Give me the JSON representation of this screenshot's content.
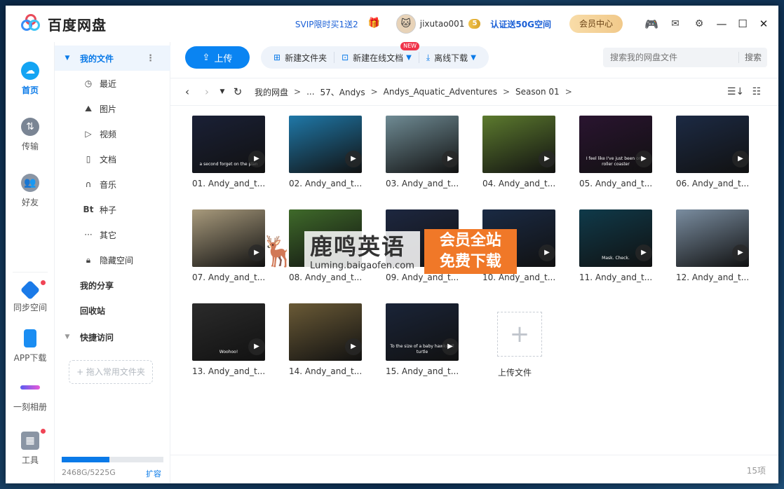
{
  "app": {
    "title": "百度网盘"
  },
  "header": {
    "promo": "SVIP限时买1送2",
    "username": "jixutao001",
    "level": "5",
    "verify_promo": "认证送50G空间",
    "vip_center": "会员中心"
  },
  "rail": {
    "items": [
      {
        "label": "首页",
        "icon": "cloud-icon",
        "active": true
      },
      {
        "label": "传输",
        "icon": "transfer-icon"
      },
      {
        "label": "好友",
        "icon": "friends-icon"
      },
      {
        "label": "同步空间",
        "icon": "sync-icon",
        "badge": true
      },
      {
        "label": "APP下载",
        "icon": "phone-icon"
      },
      {
        "label": "一刻相册",
        "icon": "album-icon"
      },
      {
        "label": "工具",
        "icon": "tools-icon",
        "badge": true
      }
    ]
  },
  "sidebar": {
    "my_files": "我的文件",
    "items": [
      {
        "label": "最近",
        "icon": "clock-icon"
      },
      {
        "label": "图片",
        "icon": "image-icon"
      },
      {
        "label": "视频",
        "icon": "play-icon"
      },
      {
        "label": "文档",
        "icon": "document-icon"
      },
      {
        "label": "音乐",
        "icon": "headphones-icon"
      },
      {
        "label": "种子",
        "icon": "bt-icon"
      },
      {
        "label": "其它",
        "icon": "more-icon"
      },
      {
        "label": "隐藏空间",
        "icon": "lock-icon"
      }
    ],
    "my_share": "我的分享",
    "recycle": "回收站",
    "quick_access": "快捷访问",
    "add_folder": "+ 拖入常用文件夹",
    "storage": {
      "text": "2468G/5225G",
      "used_fraction": 0.47
    },
    "expand": "扩容"
  },
  "toolbar": {
    "upload": "上传",
    "new_folder": "新建文件夹",
    "new_doc": "新建在线文档",
    "new_badge": "NEW",
    "offline": "离线下载",
    "search_placeholder": "搜索我的网盘文件",
    "search_btn": "搜索"
  },
  "breadcrumb": [
    "我的网盘",
    "...",
    "57、Andys",
    "Andys_Aquatic_Adventures",
    "Season 01"
  ],
  "files": [
    {
      "name": "01. Andy_and_t...",
      "caption": "a second forget on the plan",
      "bg": "#1a2036"
    },
    {
      "name": "02. Andy_and_t...",
      "caption": "",
      "bg": "#1f78a8"
    },
    {
      "name": "03. Andy_and_t...",
      "caption": "",
      "bg": "#6f8b94"
    },
    {
      "name": "04. Andy_and_t...",
      "caption": "",
      "bg": "#5c7a2e"
    },
    {
      "name": "05. Andy_and_t...",
      "caption": "I feel like I've just been on a roller coaster",
      "bg": "#2a1430"
    },
    {
      "name": "06. Andy_and_t...",
      "caption": "",
      "bg": "#1c2a44"
    },
    {
      "name": "07. Andy_and_t...",
      "caption": "",
      "bg": "#a89a7c"
    },
    {
      "name": "08. Andy_and_t...",
      "caption": "",
      "bg": "#3f6a2a"
    },
    {
      "name": "09. Andy_and_t...",
      "caption": "",
      "bg": "#1d2740"
    },
    {
      "name": "10. Andy_and_t...",
      "caption": "",
      "bg": "#1a2a44"
    },
    {
      "name": "11. Andy_and_t...",
      "caption": "Mask. Check.",
      "bg": "#0f3a4a"
    },
    {
      "name": "12. Andy_and_t...",
      "caption": "",
      "bg": "#7a8da0"
    },
    {
      "name": "13. Andy_and_t...",
      "caption": "Woohoo!",
      "bg": "#2b2b2b"
    },
    {
      "name": "14. Andy_and_t...",
      "caption": "",
      "bg": "#6a5a36"
    },
    {
      "name": "15. Andy_and_t...",
      "caption": "To the size of a baby hawksbill turtle",
      "bg": "#1a2438"
    }
  ],
  "upload_tile": "上传文件",
  "status": {
    "count": "15项"
  },
  "watermark": {
    "title": "鹿鸣英语",
    "url": "Luming.baigaofen.com",
    "tag_line1": "会员全站",
    "tag_line2": "免费下载"
  }
}
